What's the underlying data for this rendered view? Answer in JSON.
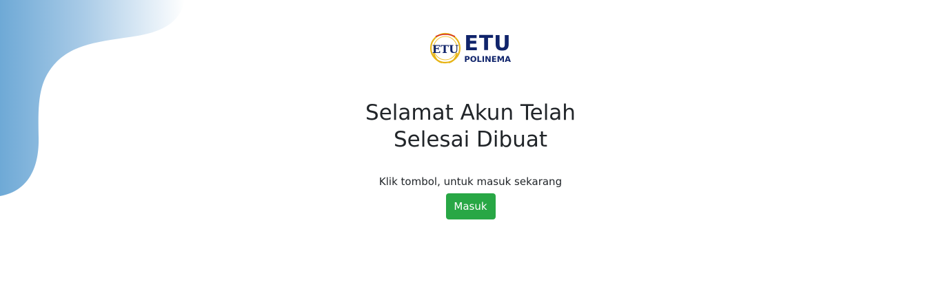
{
  "logo": {
    "seal_text": "ETU",
    "brand": "ETU",
    "sub": "POLINEMA"
  },
  "main": {
    "title_line1": "Selamat Akun Telah",
    "title_line2": "Selesai Dibuat",
    "subtitle": "Klik tombol, untuk masuk sekarang",
    "button_label": "Masuk"
  },
  "colors": {
    "button": "#28a745",
    "brand_navy": "#10246b",
    "blob_start": "#74aed8",
    "blob_end": "#ffffff"
  }
}
